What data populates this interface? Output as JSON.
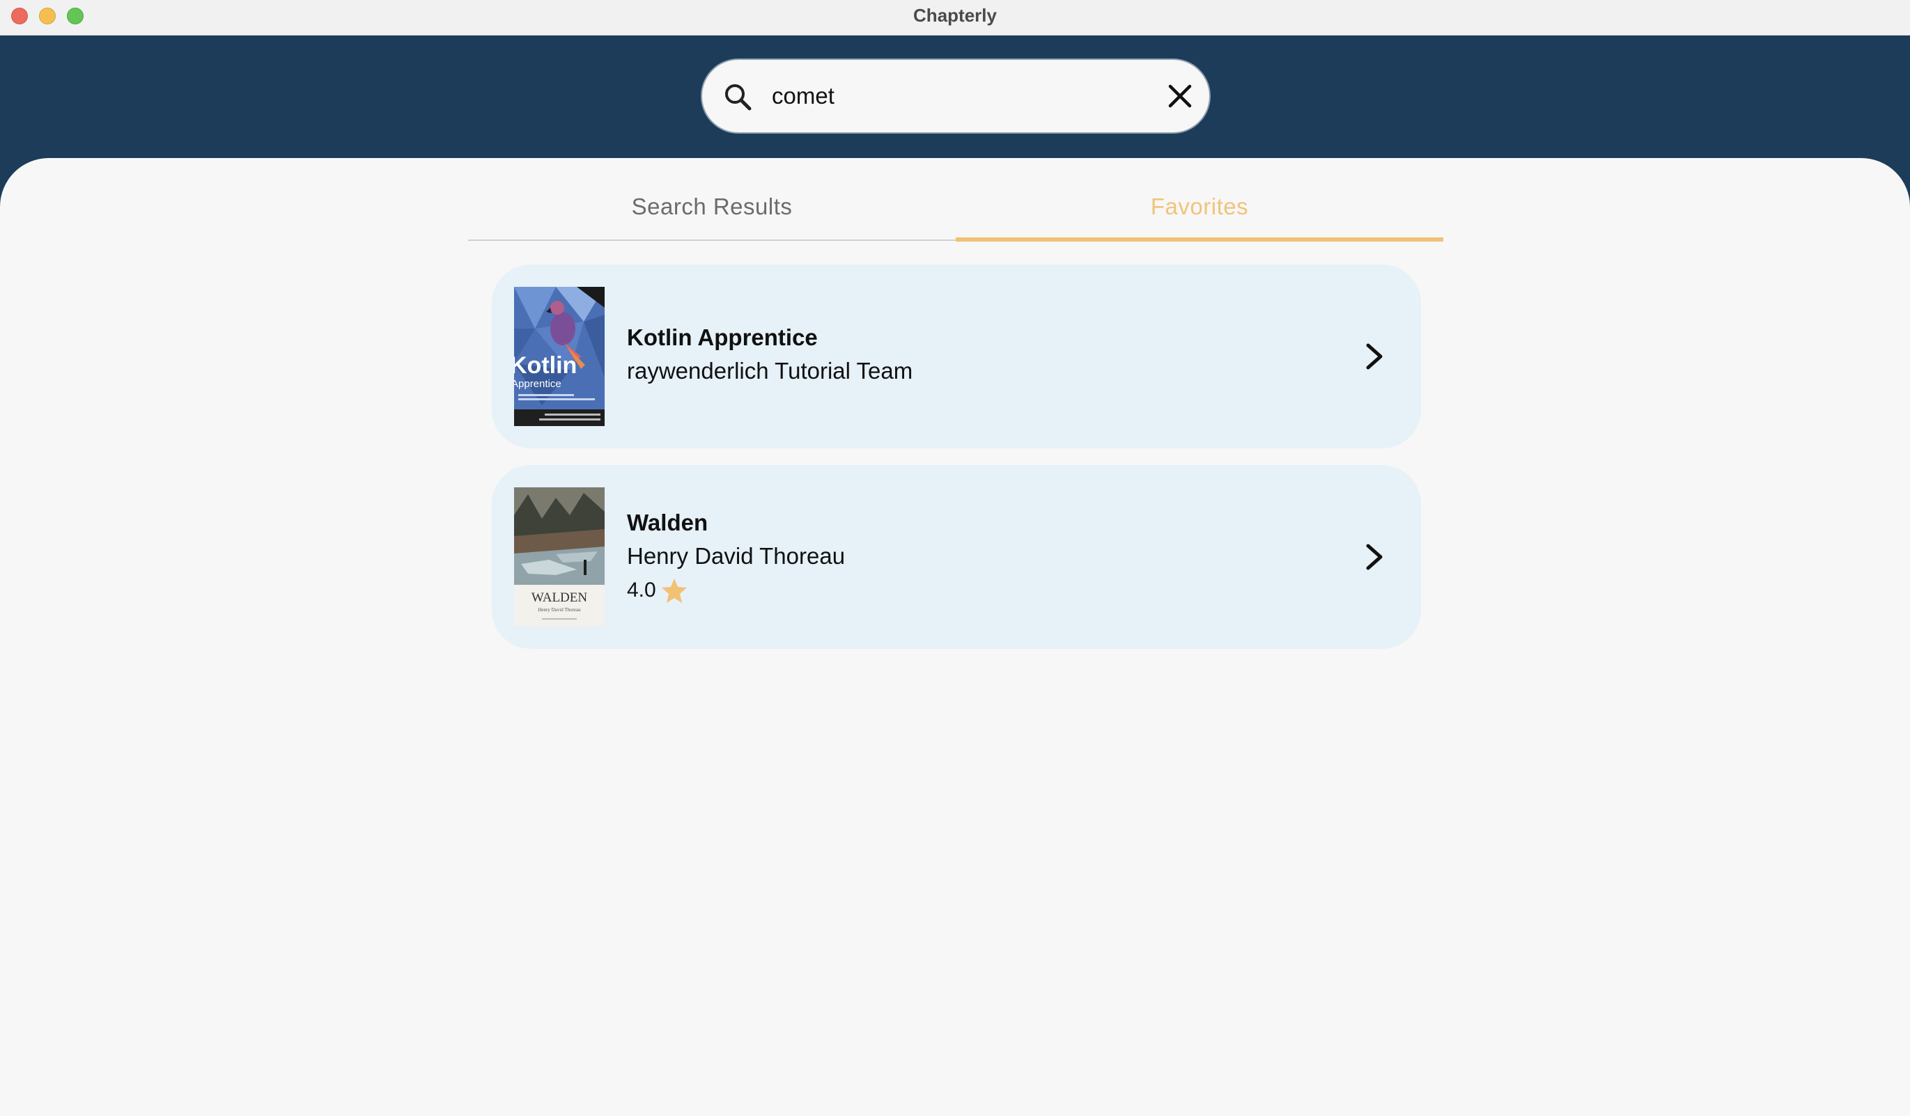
{
  "window": {
    "title": "Chapterly"
  },
  "search": {
    "query": "comet",
    "placeholder": ""
  },
  "tabs": [
    {
      "label": "Search Results",
      "active": false
    },
    {
      "label": "Favorites",
      "active": true
    }
  ],
  "favorites": [
    {
      "title": "Kotlin Apprentice",
      "author": "raywenderlich Tutorial Team",
      "cover_text": "Kotlin",
      "cover_subtext": "Apprentice"
    },
    {
      "title": "Walden",
      "author": "Henry David Thoreau",
      "rating": "4.0",
      "cover_text": "WALDEN",
      "cover_subtext": "Henry David Thoreau"
    }
  ],
  "colors": {
    "header": "#1c3c59",
    "accent": "#f2c174",
    "card": "#e6f1f8",
    "background": "#f7f7f7"
  },
  "icons": {
    "search": "search-icon",
    "clear": "close-icon",
    "chevron": "chevron-right-icon",
    "star": "star-icon"
  }
}
